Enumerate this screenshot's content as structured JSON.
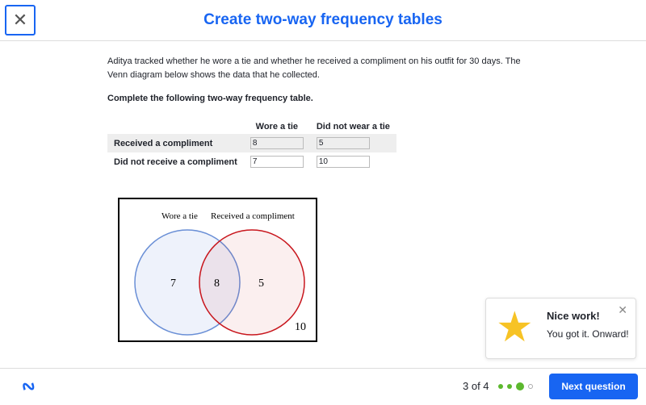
{
  "header": {
    "title": "Create two-way frequency tables",
    "close_icon": "close-icon"
  },
  "question": {
    "prompt": "Aditya tracked whether he wore a tie and whether he received a compliment on his outfit for 30 days. The Venn diagram below shows the data that he collected.",
    "instruction": "Complete the following two-way frequency table."
  },
  "table": {
    "columns": [
      "Wore a tie",
      "Did not wear a tie"
    ],
    "rows": [
      {
        "label": "Received a compliment",
        "values": [
          "8",
          "5"
        ]
      },
      {
        "label": "Did not receive a compliment",
        "values": [
          "7",
          "10"
        ]
      }
    ]
  },
  "venn": {
    "label_a": "Wore a tie",
    "label_b": "Received a compliment",
    "only_a": "7",
    "both": "8",
    "only_b": "5",
    "neither": "10",
    "color_a": "#6a8fd6",
    "color_b": "#c8161d"
  },
  "footer": {
    "progress": "3 of 4",
    "current": 3,
    "total": 4,
    "next_label": "Next question"
  },
  "toast": {
    "title": "Nice work!",
    "message": "You got it. Onward!"
  }
}
